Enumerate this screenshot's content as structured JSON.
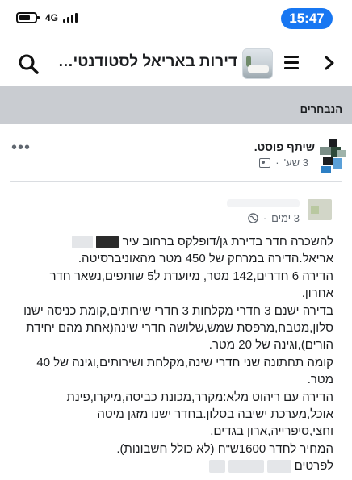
{
  "status_bar": {
    "time": "15:47",
    "network": "4G",
    "colors": {
      "time_pill": "#1877f2"
    }
  },
  "header": {
    "group_title": "דירות באריאל לסטודנטים ד...",
    "icons": {
      "search": "search-icon",
      "menu": "menu-icon",
      "back": "chevron-right-icon",
      "thumb": "group-thumbnail"
    }
  },
  "featured": {
    "label": "הנבחרים"
  },
  "post": {
    "shared_text": "שיתף פוסט.",
    "time": "3 שע'",
    "separator": "·",
    "privacy_icon": "group-icon",
    "more_icon": "more-horizontal-icon"
  },
  "shared_post": {
    "time": "3 ימים",
    "separator": "·",
    "privacy_icon": "globe-icon",
    "body": {
      "line_1": "להשכרה חדר בדירת גן/דופלקס ברחוב עיר",
      "line_2": "אריאל.הדירה במרחק של 450 מטר מהאוניברסיטה.",
      "line_3": "הדירה 6 חדרים,142 מטר, מיועדת ל5 שותפים,נשאר חדר",
      "line_4": "אחרון.",
      "line_5": "בדירה ישנם 3 חדרי מקלחות 3 חדרי שירותים,קומת כניסה ישנו",
      "line_6": "סלון,מטבח,מרפסת שמש,שלושה חדרי שינה(אחת מהם יחידת",
      "line_7": "הורים),וגינה של 20 מטר.",
      "line_8": "קומה תחתונה שני חדרי שינה,מקלחת ושירותים,וגינה של 40",
      "line_9": "מטר.",
      "line_10": "הדירה עם ריהוט מלא:מקרר,מכונת כביסה,מיקרו,פינת",
      "line_11": "אוכל,מערכת ישיבה בסלון.בחדר ישנו מזגן מיטה",
      "line_12": "וחצי,סיפרייה,ארון בגדים.",
      "line_13": "המחיר לחדר 1600ש\"ח (לא כולל חשבונות).",
      "line_14": "לפרטים"
    }
  }
}
